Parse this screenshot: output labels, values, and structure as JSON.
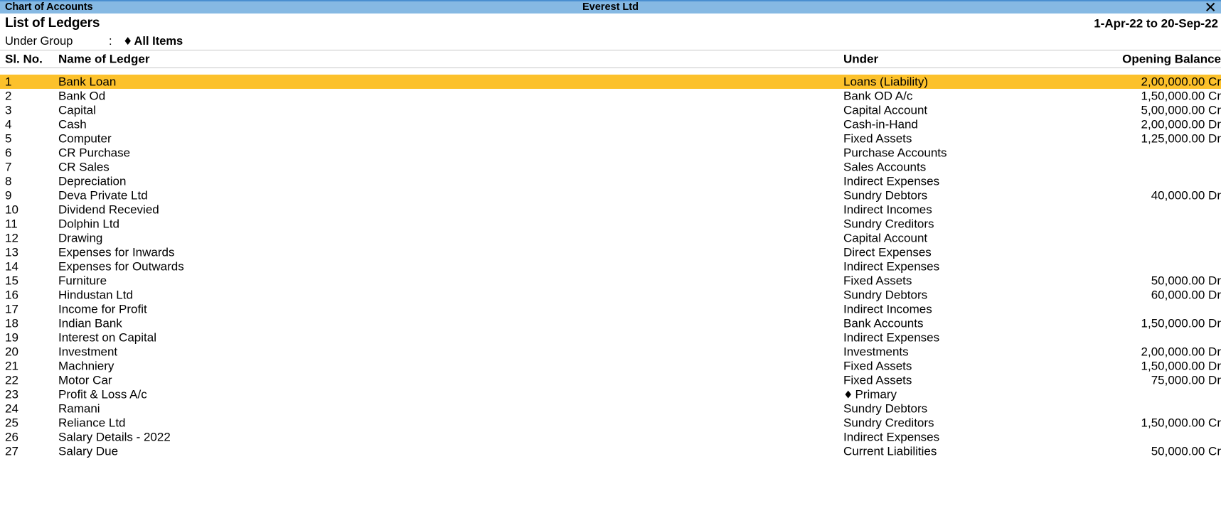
{
  "window": {
    "title": "Chart of Accounts",
    "company": "Everest Ltd",
    "close_icon": "close-icon",
    "close_glyph": "✕",
    "titlebar_color": "#86b9e3",
    "highlight_color": "#fcc12b"
  },
  "report": {
    "title": "List of Ledgers",
    "period": "1-Apr-22 to 20-Sep-22",
    "filter_label": "Under Group",
    "filter_colon": ":",
    "filter_diamond": "♦",
    "filter_value": "All Items"
  },
  "table": {
    "columns": {
      "sl_no": "Sl. No.",
      "name": "Name of Ledger",
      "under": "Under",
      "opening_balance": "Opening Balance"
    },
    "selected_index": 0,
    "rows": [
      {
        "sl": "1",
        "name": "Bank Loan",
        "under": "Loans (Liability)",
        "under_diamond": "",
        "balance": "2,00,000.00 Cr"
      },
      {
        "sl": "2",
        "name": "Bank Od",
        "under": "Bank OD A/c",
        "under_diamond": "",
        "balance": "1,50,000.00 Cr"
      },
      {
        "sl": "3",
        "name": "Capital",
        "under": "Capital Account",
        "under_diamond": "",
        "balance": "5,00,000.00 Cr"
      },
      {
        "sl": "4",
        "name": "Cash",
        "under": "Cash-in-Hand",
        "under_diamond": "",
        "balance": "2,00,000.00 Dr"
      },
      {
        "sl": "5",
        "name": "Computer",
        "under": "Fixed Assets",
        "under_diamond": "",
        "balance": "1,25,000.00 Dr"
      },
      {
        "sl": "6",
        "name": "CR Purchase",
        "under": "Purchase Accounts",
        "under_diamond": "",
        "balance": ""
      },
      {
        "sl": "7",
        "name": "CR Sales",
        "under": "Sales Accounts",
        "under_diamond": "",
        "balance": ""
      },
      {
        "sl": "8",
        "name": "Depreciation",
        "under": "Indirect Expenses",
        "under_diamond": "",
        "balance": ""
      },
      {
        "sl": "9",
        "name": "Deva Private Ltd",
        "under": "Sundry Debtors",
        "under_diamond": "",
        "balance": "40,000.00 Dr"
      },
      {
        "sl": "10",
        "name": "Dividend Recevied",
        "under": "Indirect Incomes",
        "under_diamond": "",
        "balance": ""
      },
      {
        "sl": "11",
        "name": "Dolphin Ltd",
        "under": "Sundry Creditors",
        "under_diamond": "",
        "balance": ""
      },
      {
        "sl": "12",
        "name": "Drawing",
        "under": "Capital Account",
        "under_diamond": "",
        "balance": ""
      },
      {
        "sl": "13",
        "name": "Expenses for Inwards",
        "under": "Direct Expenses",
        "under_diamond": "",
        "balance": ""
      },
      {
        "sl": "14",
        "name": "Expenses for Outwards",
        "under": "Indirect Expenses",
        "under_diamond": "",
        "balance": ""
      },
      {
        "sl": "15",
        "name": "Furniture",
        "under": "Fixed Assets",
        "under_diamond": "",
        "balance": "50,000.00 Dr"
      },
      {
        "sl": "16",
        "name": "Hindustan Ltd",
        "under": "Sundry Debtors",
        "under_diamond": "",
        "balance": "60,000.00 Dr"
      },
      {
        "sl": "17",
        "name": "Income for Profit",
        "under": "Indirect Incomes",
        "under_diamond": "",
        "balance": ""
      },
      {
        "sl": "18",
        "name": "Indian Bank",
        "under": "Bank Accounts",
        "under_diamond": "",
        "balance": "1,50,000.00 Dr"
      },
      {
        "sl": "19",
        "name": "Interest on Capital",
        "under": "Indirect Expenses",
        "under_diamond": "",
        "balance": ""
      },
      {
        "sl": "20",
        "name": "Investment",
        "under": "Investments",
        "under_diamond": "",
        "balance": "2,00,000.00 Dr"
      },
      {
        "sl": "21",
        "name": "Machniery",
        "under": "Fixed Assets",
        "under_diamond": "",
        "balance": "1,50,000.00 Dr"
      },
      {
        "sl": "22",
        "name": "Motor Car",
        "under": "Fixed Assets",
        "under_diamond": "",
        "balance": "75,000.00 Dr"
      },
      {
        "sl": "23",
        "name": "Profit & Loss A/c",
        "under": "Primary",
        "under_diamond": "♦",
        "balance": ""
      },
      {
        "sl": "24",
        "name": "Ramani",
        "under": "Sundry Debtors",
        "under_diamond": "",
        "balance": ""
      },
      {
        "sl": "25",
        "name": "Reliance Ltd",
        "under": "Sundry Creditors",
        "under_diamond": "",
        "balance": "1,50,000.00 Cr"
      },
      {
        "sl": "26",
        "name": "Salary Details - 2022",
        "under": "Indirect Expenses",
        "under_diamond": "",
        "balance": ""
      },
      {
        "sl": "27",
        "name": "Salary Due",
        "under": "Current Liabilities",
        "under_diamond": "",
        "balance": "50,000.00 Cr"
      }
    ]
  }
}
